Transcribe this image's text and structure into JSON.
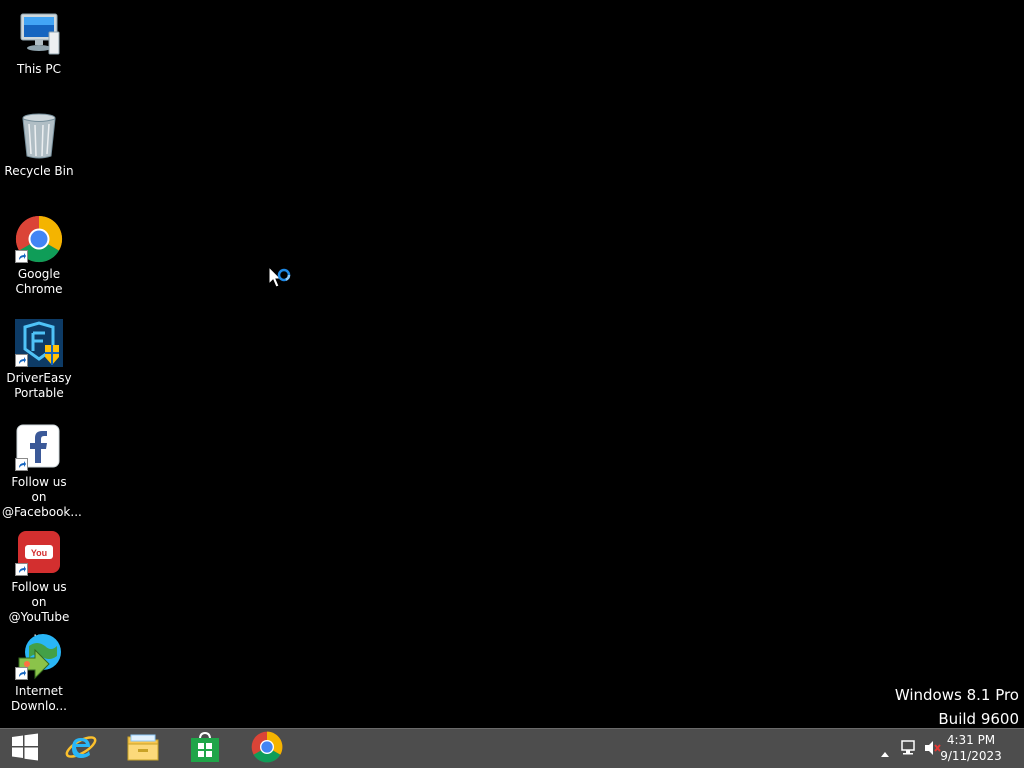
{
  "desktop": {
    "icons": [
      {
        "label": "This PC",
        "icon": "computer-icon"
      },
      {
        "label": "Recycle Bin",
        "icon": "recycle-bin-icon"
      },
      {
        "label": "Google\nChrome",
        "icon": "chrome-icon"
      },
      {
        "label": "DriverEasy\nPortable",
        "icon": "drivereasy-icon"
      },
      {
        "label": "Follow us on\n@Facebook...",
        "icon": "facebook-icon"
      },
      {
        "label": "Follow us on\n@YouTube ...",
        "icon": "youtube-icon"
      },
      {
        "label": "Internet\nDownlo...",
        "icon": "internet-download-manager-icon"
      }
    ],
    "watermark": {
      "line1": "Windows 8.1 Pro",
      "line2": "Build 9600"
    }
  },
  "taskbar": {
    "pinned": [
      {
        "name": "start-button",
        "icon": "windows-logo-icon"
      },
      {
        "name": "internet-explorer",
        "icon": "internet-explorer-icon"
      },
      {
        "name": "file-explorer",
        "icon": "file-explorer-icon"
      },
      {
        "name": "windows-store",
        "icon": "store-icon"
      },
      {
        "name": "google-chrome",
        "icon": "chrome-icon"
      }
    ],
    "tray": {
      "icons": [
        "chevron-up-icon",
        "network-icon",
        "volume-muted-icon"
      ],
      "time": "4:31 PM",
      "date": "9/11/2023"
    }
  },
  "colors": {
    "desktop_bg": "#000000",
    "taskbar_bg": "#4d4d4d",
    "text": "#ffffff",
    "accent_blue": "#1e88e5"
  }
}
